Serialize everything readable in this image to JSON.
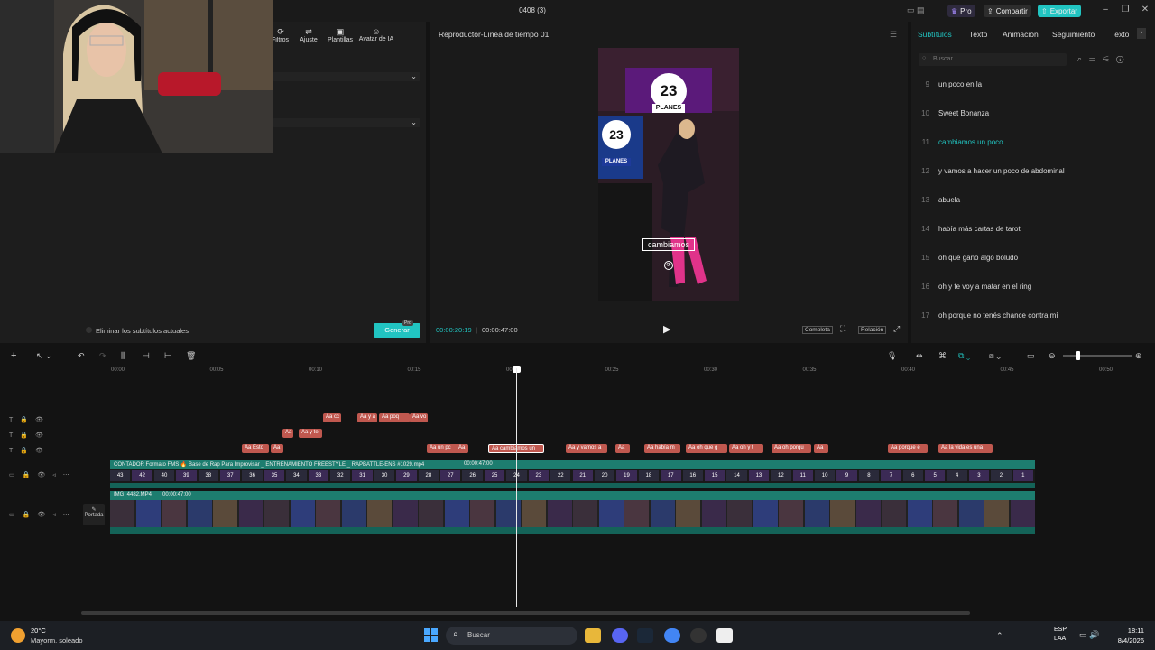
{
  "window": {
    "title": "0408 (3)"
  },
  "header": {
    "pro_label": "Pro",
    "share_label": "Compartir",
    "export_label": "Exportar",
    "accent": "#21c4c1"
  },
  "left_tools": [
    {
      "label": "Filtros"
    },
    {
      "label": "Ajuste"
    },
    {
      "label": "Plantillas"
    },
    {
      "label": "Avatar de IA"
    }
  ],
  "left_bottom": {
    "remove_subtitles_label": "Eliminar los subtítulos actuales",
    "generate_label": "Generar",
    "pro_badge": "Pro"
  },
  "player": {
    "title": "Reproductor-Línea de tiempo 01",
    "current_time": "00:00:20:19",
    "total_time": "00:00:47:00",
    "fit_label": "Completa",
    "ratio_label": "Relación",
    "overlay_number": "23",
    "overlay_text": "PLANES",
    "caption": "cambiamos"
  },
  "right_tabs": [
    "Subtítulos",
    "Texto",
    "Animación",
    "Seguimiento",
    "Texto"
  ],
  "right_search": {
    "placeholder": "Buscar"
  },
  "subtitles": [
    {
      "num": "9",
      "text": "un poco en la",
      "active": false
    },
    {
      "num": "10",
      "text": "Sweet Bonanza",
      "active": false
    },
    {
      "num": "11",
      "text": "cambiamos un poco",
      "active": true
    },
    {
      "num": "12",
      "text": "y vamos a hacer un poco de abdominal",
      "active": false
    },
    {
      "num": "13",
      "text": "abuela",
      "active": false
    },
    {
      "num": "14",
      "text": "había más cartas de tarot",
      "active": false
    },
    {
      "num": "15",
      "text": "oh que ganó algo boludo",
      "active": false
    },
    {
      "num": "16",
      "text": "oh y te voy a matar en el ring",
      "active": false
    },
    {
      "num": "17",
      "text": "oh porque no tenés chance contra mí",
      "active": false
    }
  ],
  "timeline": {
    "ruler": [
      "00:00",
      "00:05",
      "00:10",
      "00:15",
      "00:20",
      "00:25",
      "00:30",
      "00:35",
      "00:40",
      "00:45",
      "00:50"
    ],
    "sub_rows": [
      [
        {
          "text": "Aa cc"
        },
        {
          "text": "Aa y a"
        },
        {
          "text": "Aa poq"
        },
        {
          "text": "Aa vo"
        }
      ],
      [
        {
          "text": "Aa"
        },
        {
          "text": "Aa y te"
        }
      ],
      [
        {
          "text": "Aa Esto"
        },
        {
          "text": "Aa"
        },
        {
          "text": "Aa un pc"
        },
        {
          "text": "Aa"
        },
        {
          "text": "Aa cambiamos un"
        },
        {
          "text": "Aa y vamos a"
        },
        {
          "text": "Aa"
        },
        {
          "text": "Aa había m"
        },
        {
          "text": "Aa oh que g"
        },
        {
          "text": "Aa oh y t"
        },
        {
          "text": "Aa oh porqu"
        },
        {
          "text": "Aa"
        },
        {
          "text": "Aa porque e"
        },
        {
          "text": "Aa la vida es una"
        }
      ]
    ],
    "video1_label": "CONTADOR Formato FMS 🔥 Base de Rap Para Improvisar _ ENTRENAMIENTO FREESTYLE _ RAPBATTLE-ENS #1029.mp4",
    "video1_duration": "00:00:47:00",
    "video1_numbers": [
      "43",
      "42",
      "40",
      "39",
      "38",
      "37",
      "36",
      "35",
      "34",
      "33",
      "32",
      "31",
      "30",
      "29",
      "28",
      "27",
      "26",
      "25",
      "24",
      "23",
      "22",
      "21",
      "20",
      "19",
      "18",
      "17",
      "16",
      "15",
      "14",
      "13",
      "12",
      "11",
      "10",
      "9",
      "8",
      "7",
      "6",
      "5",
      "4",
      "3",
      "2",
      "1"
    ],
    "video2_label": "IMG_4482.MP4",
    "video2_duration": "00:00:47:00",
    "cover_label": "Portada"
  },
  "taskbar": {
    "weather_temp": "20°C",
    "weather_desc": "Mayorm. soleado",
    "search_placeholder": "Buscar",
    "lang": "ESP",
    "lang2": "LAA",
    "time": "18:11",
    "date": "8/4/2026"
  }
}
